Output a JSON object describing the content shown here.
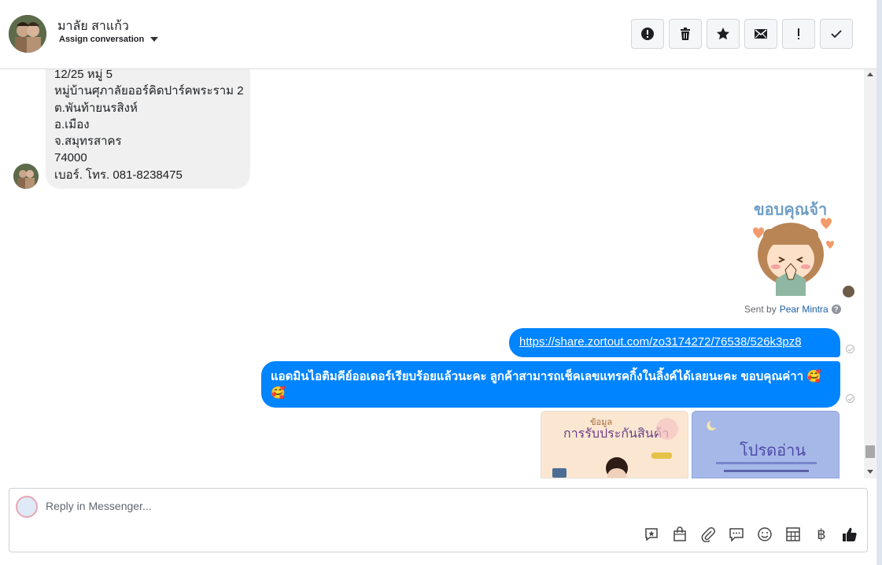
{
  "header": {
    "name": "มาลัย สาแก้ว",
    "assign_label": "Assign conversation",
    "actions": [
      "report-icon",
      "trash-icon",
      "star-icon",
      "envelope-icon",
      "exclamation-icon",
      "checkmark-icon"
    ]
  },
  "incoming_message": {
    "lines": [
      "12/25 หมู่ 5",
      "หมู่บ้านศุภาลัยออร์คิดปาร์คพระราม 2",
      "ต.พันท้ายนรสิงห์",
      "อ.เมือง",
      "จ.สมุทรสาคร",
      "74000",
      "เบอร์. โทร. 081-8238475"
    ]
  },
  "sticker": {
    "text": "ขอบคุณจ้า"
  },
  "sent_by": {
    "prefix": "Sent by",
    "name": "Pear Mintra",
    "help": "?"
  },
  "outgoing": {
    "link": "https://share.zortout.com/zo3174272/76538/526k3pz8",
    "text": "แอดมินไอติมคีย์ออเดอร์เรียบร้อยแล้วนะคะ ลูกค้าสามารถเช็คเลขแทรคกิ้งในลิ้งค์ได้เลยนะคะ ขอบคุณค่าา 🥰 🥰"
  },
  "image_cards": [
    {
      "title": "การรับประกันสินค้า",
      "subtitle": "ข้อมูล"
    },
    {
      "title": "โปรดอ่าน"
    }
  ],
  "reply": {
    "placeholder": "Reply in Messenger..."
  },
  "tools": [
    "saved-reply-icon",
    "shopping-bag-icon",
    "paperclip-icon",
    "chat-bubble-icon",
    "emoji-icon",
    "table-icon",
    "baht-icon",
    "thumbs-up-icon"
  ],
  "colors": {
    "brand_blue": "#0084ff",
    "incoming_bubble": "#f0f0f0"
  }
}
